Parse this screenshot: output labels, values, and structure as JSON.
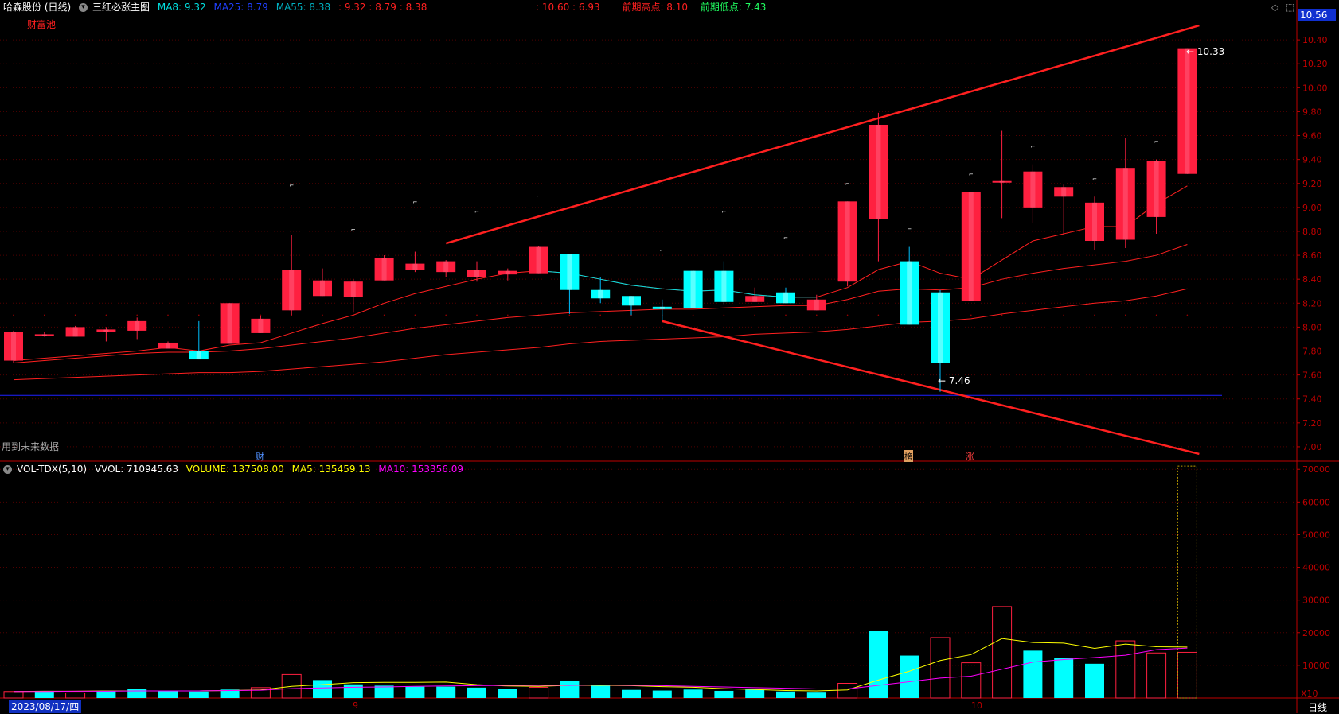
{
  "header": {
    "stock_name": "哈森股份 (日线)",
    "formula_name": "三红必涨主图",
    "ma8": "MA8: 9.32",
    "ma25": "MA25: 8.79",
    "ma55": "MA55: 8.38",
    "ma_values": ": 9.32 : 8.79 : 8.38",
    "range_values": ": 10.60 : 6.93",
    "prev_high": "前期高点: 8.10",
    "prev_low": "前期低点: 7.43",
    "sub_label": "财富池",
    "current_price": "10.56"
  },
  "main_panel": {
    "warning": "用到未来数据",
    "markers": {
      "cai": "财",
      "bang": "榜",
      "zhang": "涨"
    },
    "high_label": "10.33",
    "low_label": "7.46"
  },
  "volume_panel": {
    "title": "VOL-TDX(5,10)",
    "vvol": "VVOL: 710945.63",
    "volume": "VOLUME: 137508.00",
    "ma5": "MA5: 135459.13",
    "ma10": "MA10: 153356.09",
    "multiplier": "X10"
  },
  "footer": {
    "date": "2023/08/17/四",
    "period": "日线",
    "month_sep": "9",
    "month_oct": "10"
  },
  "colors": {
    "up": "#ff2040",
    "down": "#00ffff",
    "axis": "#c00000",
    "ma5": "#ffff00",
    "ma10": "#ff00ff",
    "blue_line": "#2020ff"
  },
  "chart_data": [
    {
      "type": "candlestick",
      "y_ticks": [
        "10.40",
        "10.20",
        "10.00",
        "9.80",
        "9.60",
        "9.40",
        "9.20",
        "9.00",
        "8.80",
        "8.60",
        "8.40",
        "8.20",
        "8.00",
        "7.80",
        "7.60",
        "7.40",
        "7.20",
        "7.00"
      ],
      "ylim": [
        6.88,
        10.6
      ],
      "candles": [
        {
          "o": 7.72,
          "c": 7.96,
          "h": 7.97,
          "l": 7.7,
          "up": true
        },
        {
          "o": 7.93,
          "c": 7.94,
          "h": 7.96,
          "l": 7.92,
          "up": true
        },
        {
          "o": 7.92,
          "c": 8.0,
          "h": 8.01,
          "l": 7.92,
          "up": true
        },
        {
          "o": 7.96,
          "c": 7.98,
          "h": 8.0,
          "l": 7.88,
          "up": true
        },
        {
          "o": 7.97,
          "c": 8.05,
          "h": 8.08,
          "l": 7.9,
          "up": true
        },
        {
          "o": 7.82,
          "c": 7.87,
          "h": 7.88,
          "l": 7.82,
          "up": true
        },
        {
          "o": 7.8,
          "c": 7.73,
          "h": 8.05,
          "l": 7.73,
          "up": false
        },
        {
          "o": 7.86,
          "c": 8.2,
          "h": 8.2,
          "l": 7.86,
          "up": true
        },
        {
          "o": 7.95,
          "c": 8.07,
          "h": 8.09,
          "l": 7.95,
          "up": true
        },
        {
          "o": 8.14,
          "c": 8.48,
          "h": 8.77,
          "l": 8.1,
          "up": true
        },
        {
          "o": 8.26,
          "c": 8.39,
          "h": 8.49,
          "l": 8.26,
          "up": true
        },
        {
          "o": 8.25,
          "c": 8.38,
          "h": 8.4,
          "l": 8.12,
          "up": true
        },
        {
          "o": 8.39,
          "c": 8.58,
          "h": 8.6,
          "l": 8.39,
          "up": true
        },
        {
          "o": 8.48,
          "c": 8.53,
          "h": 8.63,
          "l": 8.46,
          "up": true
        },
        {
          "o": 8.46,
          "c": 8.55,
          "h": 8.56,
          "l": 8.42,
          "up": true
        },
        {
          "o": 8.42,
          "c": 8.48,
          "h": 8.55,
          "l": 8.38,
          "up": true
        },
        {
          "o": 8.44,
          "c": 8.47,
          "h": 8.49,
          "l": 8.39,
          "up": true
        },
        {
          "o": 8.45,
          "c": 8.67,
          "h": 8.68,
          "l": 8.45,
          "up": true
        },
        {
          "o": 8.61,
          "c": 8.31,
          "h": 8.61,
          "l": 8.11,
          "up": false
        },
        {
          "o": 8.31,
          "c": 8.24,
          "h": 8.42,
          "l": 8.2,
          "up": false
        },
        {
          "o": 8.26,
          "c": 8.18,
          "h": 8.26,
          "l": 8.1,
          "up": false
        },
        {
          "o": 8.17,
          "c": 8.15,
          "h": 8.23,
          "l": 8.06,
          "up": false
        },
        {
          "o": 8.47,
          "c": 8.16,
          "h": 8.48,
          "l": 8.16,
          "up": false
        },
        {
          "o": 8.47,
          "c": 8.21,
          "h": 8.55,
          "l": 8.19,
          "up": false
        },
        {
          "o": 8.21,
          "c": 8.26,
          "h": 8.33,
          "l": 8.21,
          "up": true
        },
        {
          "o": 8.29,
          "c": 8.2,
          "h": 8.33,
          "l": 8.2,
          "up": false
        },
        {
          "o": 8.14,
          "c": 8.23,
          "h": 8.27,
          "l": 8.14,
          "up": true
        },
        {
          "o": 8.38,
          "c": 9.05,
          "h": 9.05,
          "l": 8.34,
          "up": true
        },
        {
          "o": 8.9,
          "c": 9.69,
          "h": 9.79,
          "l": 8.55,
          "up": true
        },
        {
          "o": 8.55,
          "c": 8.02,
          "h": 8.67,
          "l": 8.02,
          "up": false
        },
        {
          "o": 8.29,
          "c": 7.7,
          "h": 8.31,
          "l": 7.46,
          "up": false
        },
        {
          "o": 8.22,
          "c": 9.13,
          "h": 9.13,
          "l": 8.22,
          "up": true
        },
        {
          "o": 9.21,
          "c": 9.22,
          "h": 9.64,
          "l": 8.91,
          "up": true
        },
        {
          "o": 9.0,
          "c": 9.3,
          "h": 9.36,
          "l": 8.87,
          "up": true
        },
        {
          "o": 9.09,
          "c": 9.17,
          "h": 9.19,
          "l": 8.77,
          "up": true
        },
        {
          "o": 8.72,
          "c": 9.04,
          "h": 9.09,
          "l": 8.64,
          "up": true
        },
        {
          "o": 8.73,
          "c": 9.33,
          "h": 9.58,
          "l": 8.66,
          "up": true
        },
        {
          "o": 8.92,
          "c": 9.39,
          "h": 9.4,
          "l": 8.78,
          "up": true
        },
        {
          "o": 9.28,
          "c": 10.33,
          "h": 10.33,
          "l": 9.28,
          "up": true
        }
      ],
      "ma8": [
        7.72,
        7.74,
        7.76,
        7.78,
        7.8,
        7.83,
        7.8,
        7.85,
        7.87,
        7.95,
        8.03,
        8.1,
        8.2,
        8.28,
        8.34,
        8.4,
        8.45,
        8.47,
        8.45,
        8.4,
        8.35,
        8.32,
        8.3,
        8.31,
        8.27,
        8.25,
        8.25,
        8.33,
        8.48,
        8.55,
        8.45,
        8.4,
        8.56,
        8.72,
        8.78,
        8.84,
        8.84,
        9.03,
        9.18
      ],
      "ma25": [
        7.7,
        7.72,
        7.74,
        7.76,
        7.78,
        7.79,
        7.79,
        7.8,
        7.82,
        7.85,
        7.88,
        7.91,
        7.95,
        7.99,
        8.02,
        8.05,
        8.08,
        8.1,
        8.12,
        8.13,
        8.14,
        8.15,
        8.15,
        8.16,
        8.17,
        8.18,
        8.18,
        8.23,
        8.3,
        8.32,
        8.31,
        8.33,
        8.4,
        8.45,
        8.49,
        8.52,
        8.55,
        8.6,
        8.69
      ],
      "ma55": [
        7.56,
        7.57,
        7.58,
        7.59,
        7.6,
        7.61,
        7.62,
        7.62,
        7.63,
        7.65,
        7.67,
        7.69,
        7.71,
        7.74,
        7.77,
        7.79,
        7.81,
        7.83,
        7.86,
        7.88,
        7.89,
        7.9,
        7.91,
        7.92,
        7.94,
        7.95,
        7.96,
        7.98,
        8.01,
        8.04,
        8.05,
        8.07,
        8.11,
        8.14,
        8.17,
        8.2,
        8.22,
        8.26,
        8.32
      ],
      "blue_level": 7.43,
      "trend_upper": [
        [
          14,
          8.7
        ],
        [
          38,
          10.52
        ]
      ],
      "trend_lower": [
        [
          21,
          8.05
        ],
        [
          38,
          6.94
        ]
      ]
    },
    {
      "type": "bar",
      "y_ticks": [
        "70000",
        "60000",
        "50000",
        "40000",
        "30000",
        "20000",
        "10000"
      ],
      "ylim": [
        0,
        72000
      ],
      "volumes": [
        2000,
        2200,
        1600,
        2200,
        2800,
        2100,
        2000,
        2600,
        3200,
        7200,
        5500,
        4200,
        3800,
        3500,
        3500,
        3200,
        2900,
        3300,
        5200,
        3800,
        2500,
        2300,
        2600,
        2200,
        2600,
        2000,
        1900,
        4500,
        20500,
        13000,
        18500,
        10800,
        28000,
        14500,
        12200,
        10500,
        17500,
        13800,
        14000
      ],
      "up_flags": [
        true,
        false,
        true,
        false,
        false,
        false,
        false,
        false,
        true,
        true,
        false,
        false,
        false,
        false,
        false,
        false,
        false,
        true,
        false,
        false,
        false,
        false,
        false,
        false,
        false,
        false,
        false,
        true,
        false,
        false,
        true,
        true,
        true,
        false,
        false,
        false,
        true,
        true,
        true
      ],
      "ma5": [
        2000,
        2100,
        2100,
        2200,
        2200,
        2200,
        2200,
        2300,
        2500,
        3600,
        4100,
        4700,
        4800,
        4800,
        4900,
        4100,
        3700,
        3600,
        3900,
        3900,
        3800,
        3500,
        3300,
        2900,
        2600,
        2300,
        2200,
        2500,
        5500,
        8200,
        11500,
        13300,
        18200,
        17000,
        16800,
        15200,
        16500,
        15700,
        15600
      ],
      "ma10": [
        2000,
        2000,
        2100,
        2100,
        2200,
        2200,
        2200,
        2300,
        2400,
        2900,
        3100,
        3300,
        3400,
        3600,
        3700,
        3800,
        3900,
        3900,
        3900,
        4000,
        3900,
        3800,
        3600,
        3400,
        3200,
        3000,
        2800,
        2800,
        3900,
        5000,
        6100,
        6700,
        8800,
        11000,
        11800,
        12400,
        13100,
        14800,
        15300
      ],
      "max_bar": 71000
    }
  ]
}
